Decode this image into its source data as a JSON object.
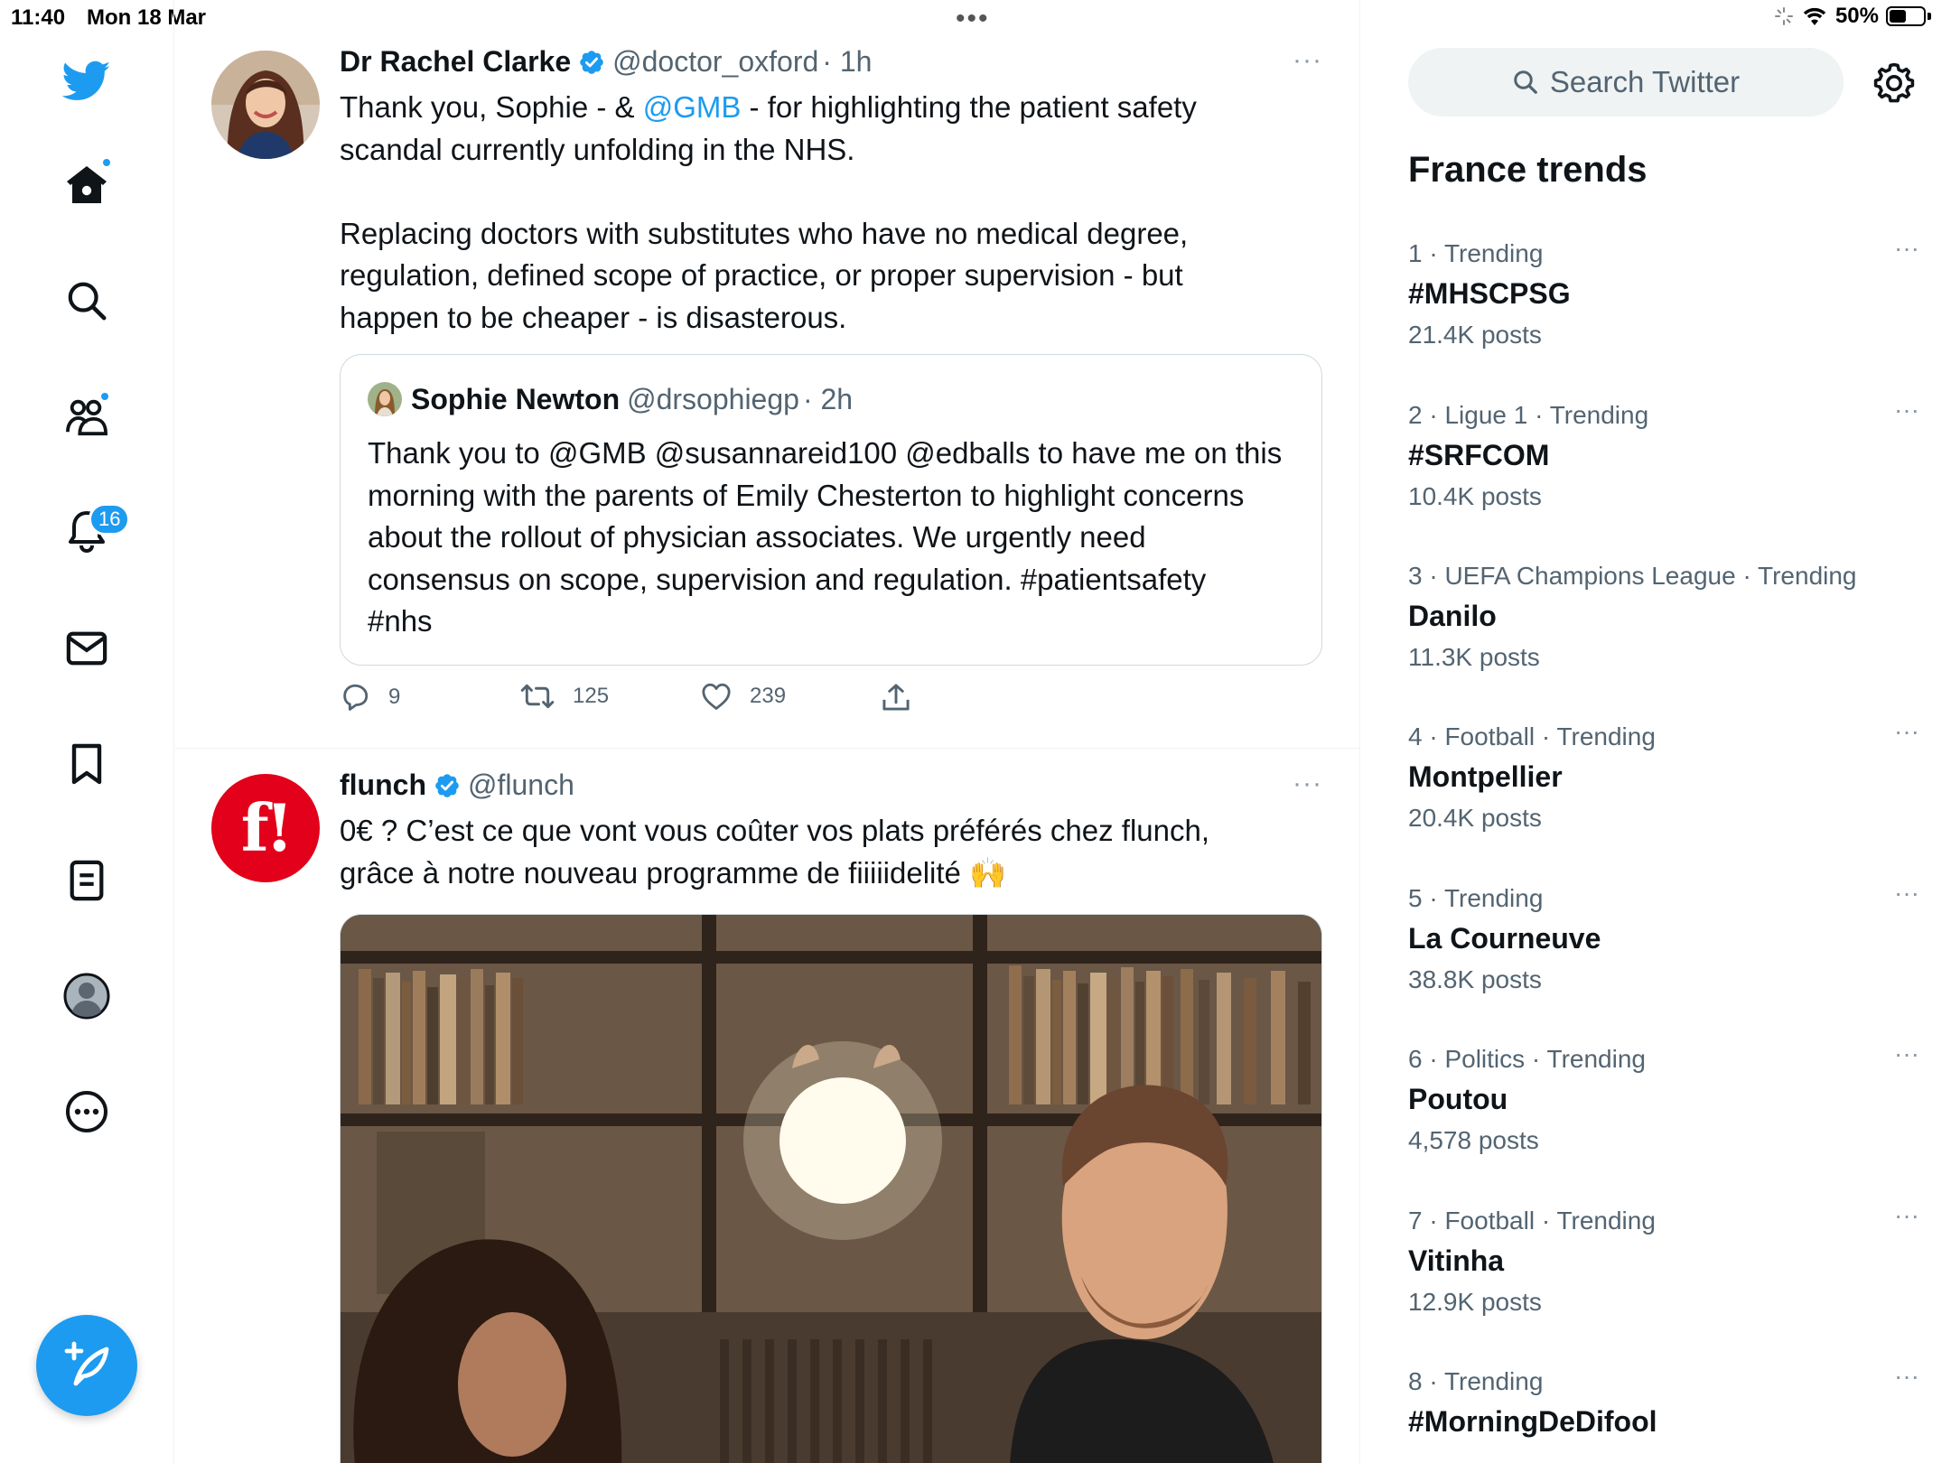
{
  "status_bar": {
    "time": "11:40",
    "date": "Mon 18 Mar",
    "battery": "50%",
    "battery_level": 0.5
  },
  "nav": {
    "notifications_badge": "16",
    "icons": [
      "twitter-logo-icon",
      "home-icon",
      "search-icon",
      "communities-icon",
      "notifications-icon",
      "messages-icon",
      "bookmarks-icon",
      "lists-icon",
      "profile-icon",
      "more-icon",
      "compose-icon"
    ]
  },
  "tweets": [
    {
      "name": "Dr Rachel Clarke",
      "handle": "@doctor_oxford",
      "time": "· 1h",
      "text_before": "Thank you, Sophie - & ",
      "mention": "@GMB",
      "text_after": " - for highlighting the patient safety\nscandal currently unfolding in the NHS.\n\nReplacing doctors with substitutes who have no medical degree,\nregulation, defined scope of practice, or proper supervision - but\nhappen to be cheaper - is disasterous.",
      "quote": {
        "name": "Sophie Newton",
        "handle": "@drsophiegp",
        "time": "· 2h",
        "text": "Thank you to @GMB @susannareid100 @edballs to have me on this\nmorning with the parents of Emily Chesterton to highlight concerns\nabout the rollout of physician associates. We urgently need\nconsensus on scope, supervision and regulation. #patientsafety\n#nhs"
      },
      "replies": "9",
      "retweets": "125",
      "likes": "239"
    },
    {
      "name": "flunch",
      "handle": "@flunch",
      "text": "0€ ? C’est ce que vont vous coûter vos plats préférés chez flunch,\ngrâce à notre nouveau programme de fiiiiidelité 🙌",
      "logo_text": "f!"
    }
  ],
  "sidebar": {
    "search_placeholder": "Search Twitter",
    "trends_title": "France trends",
    "trends": [
      {
        "meta": "1 · Trending",
        "name": "#MHSCPSG",
        "count": "21.4K posts"
      },
      {
        "meta": "2 · Ligue 1 · Trending",
        "name": "#SRFCOM",
        "count": "10.4K posts"
      },
      {
        "meta": "3 · UEFA Champions League · Trending",
        "name": "Danilo",
        "count": "11.3K posts"
      },
      {
        "meta": "4 · Football · Trending",
        "name": "Montpellier",
        "count": "20.4K posts"
      },
      {
        "meta": "5 · Trending",
        "name": "La Courneuve",
        "count": "38.8K posts"
      },
      {
        "meta": "6 · Politics · Trending",
        "name": "Poutou",
        "count": "4,578 posts"
      },
      {
        "meta": "7 · Football · Trending",
        "name": "Vitinha",
        "count": "12.9K posts"
      },
      {
        "meta": "8 · Trending",
        "name": "#MorningDeDifool",
        "count": ""
      }
    ],
    "more_glyph": "···"
  },
  "colors": {
    "accent": "#1d9bf0",
    "text": "#0f1419",
    "secondary": "#536471",
    "flunch_red": "#e2001a"
  }
}
